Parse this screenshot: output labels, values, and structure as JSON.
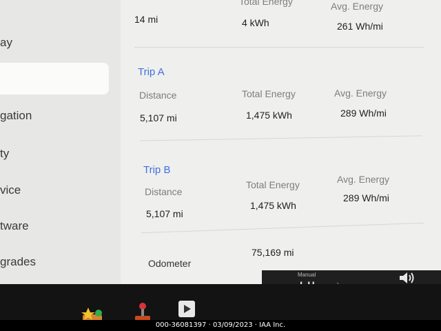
{
  "sidebar": {
    "items": [
      {
        "label": "ay"
      },
      {
        "label": ""
      },
      {
        "label": "gation"
      },
      {
        "label": "ty"
      },
      {
        "label": "vice"
      },
      {
        "label": "tware"
      },
      {
        "label": "grades"
      }
    ]
  },
  "since_last_charge": {
    "distance": "14 mi",
    "total_energy_label": "Total Energy",
    "total_energy": "4 kWh",
    "avg_energy_label": "Avg. Energy",
    "avg_energy": "261 Wh/mi"
  },
  "trip_a": {
    "title": "Trip A",
    "distance_label": "Distance",
    "distance": "5,107 mi",
    "total_energy_label": "Total Energy",
    "total_energy": "1,475 kWh",
    "avg_energy_label": "Avg. Energy",
    "avg_energy": "289 Wh/mi"
  },
  "trip_b": {
    "title": "Trip B",
    "distance_label": "Distance",
    "distance": "5,107 mi",
    "total_energy_label": "Total Energy",
    "total_energy": "1,475 kWh",
    "avg_energy_label": "Avg. Energy",
    "avg_energy": "289 Wh/mi"
  },
  "odometer": {
    "label": "Odometer",
    "value": "75,169 mi"
  },
  "climate": {
    "mode": "Manual",
    "fan": "HI"
  },
  "icons": [
    "apps-icon",
    "toybox-icon",
    "joystick-icon",
    "theater-icon",
    "volume-icon"
  ],
  "footer": "000-36081397 · 03/09/2023 · IAA Inc."
}
